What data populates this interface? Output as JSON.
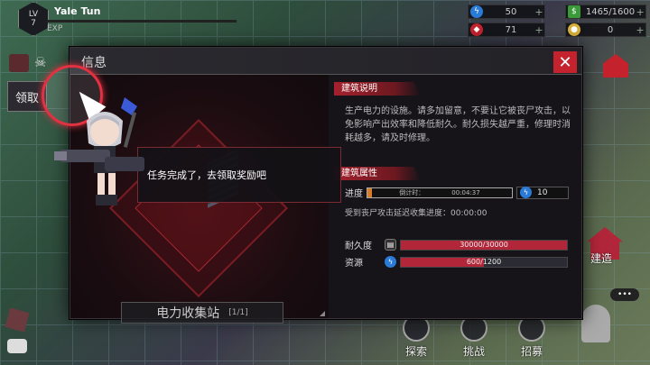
{
  "player": {
    "level_label": "LV",
    "level": "7",
    "name": "Yale Tun",
    "exp_label": "EXP"
  },
  "resources": [
    {
      "icon": "energy-icon",
      "value": "50",
      "color": "#2a7ad8"
    },
    {
      "icon": "cash-icon",
      "value": "1465/1600",
      "color": "#3a9a3a"
    },
    {
      "icon": "ruby-icon",
      "value": "71",
      "color": "#c4232e"
    },
    {
      "icon": "coin-icon",
      "value": "0",
      "color": "#d8b13a"
    }
  ],
  "modal": {
    "title": "信息",
    "close": "✕",
    "station_name": "电力收集站",
    "station_count": "[1/1]",
    "sections": {
      "description_title": "建筑说明",
      "description": "生产电力的设施。请多加留意，不要让它被丧尸攻击，以免影响产出效率和降低耐久。耐久损失越严重，修理时消耗越多，请及时修理。",
      "attributes_title": "建筑属性"
    },
    "progress": {
      "label": "进度",
      "countdown_label": "倒计时：",
      "countdown": "00:04:37",
      "fill_fraction": 0.03,
      "energy_value": "10"
    },
    "delay_text": "受到丧尸攻击延迟收集进度：00:00:00",
    "durability": {
      "label": "耐久度",
      "value": "30000/30000",
      "fraction": 1.0
    },
    "resource": {
      "label": "资源",
      "value_current": "600/",
      "value_max": "1200",
      "fraction": 0.5
    }
  },
  "tooltip": {
    "text": "任务完成了，去领取奖励吧"
  },
  "claim": {
    "label": "领取"
  },
  "bottom_nav": [
    {
      "label": "探索"
    },
    {
      "label": "挑战"
    },
    {
      "label": "招募"
    }
  ],
  "side_label": "建造",
  "chat_dots": "•••",
  "colors": {
    "accent": "#c4232e",
    "orange": "#d87c2a"
  }
}
